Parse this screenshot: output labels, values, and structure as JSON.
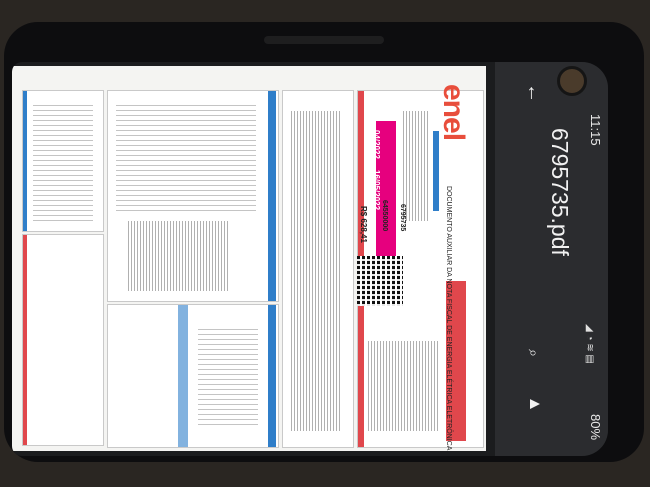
{
  "status_bar": {
    "time": "11:15",
    "battery": "80%"
  },
  "toolbar": {
    "title": "6795735.pdf"
  },
  "document": {
    "brand": "enel",
    "heading": "DOCUMENTO AUXILIAR DA NOTA FISCAL DE ENERGIA ELÉTRICA ELETRÔNICA",
    "install_code": "6795735",
    "client_code": "64550000",
    "reference": "04/2022",
    "due_date": "16/05/2022",
    "total_due": "R$ 628,41"
  },
  "colors": {
    "accent_blue": "#2f7ec9",
    "accent_red": "#e0474c",
    "brand_pink": "#e6007e"
  }
}
